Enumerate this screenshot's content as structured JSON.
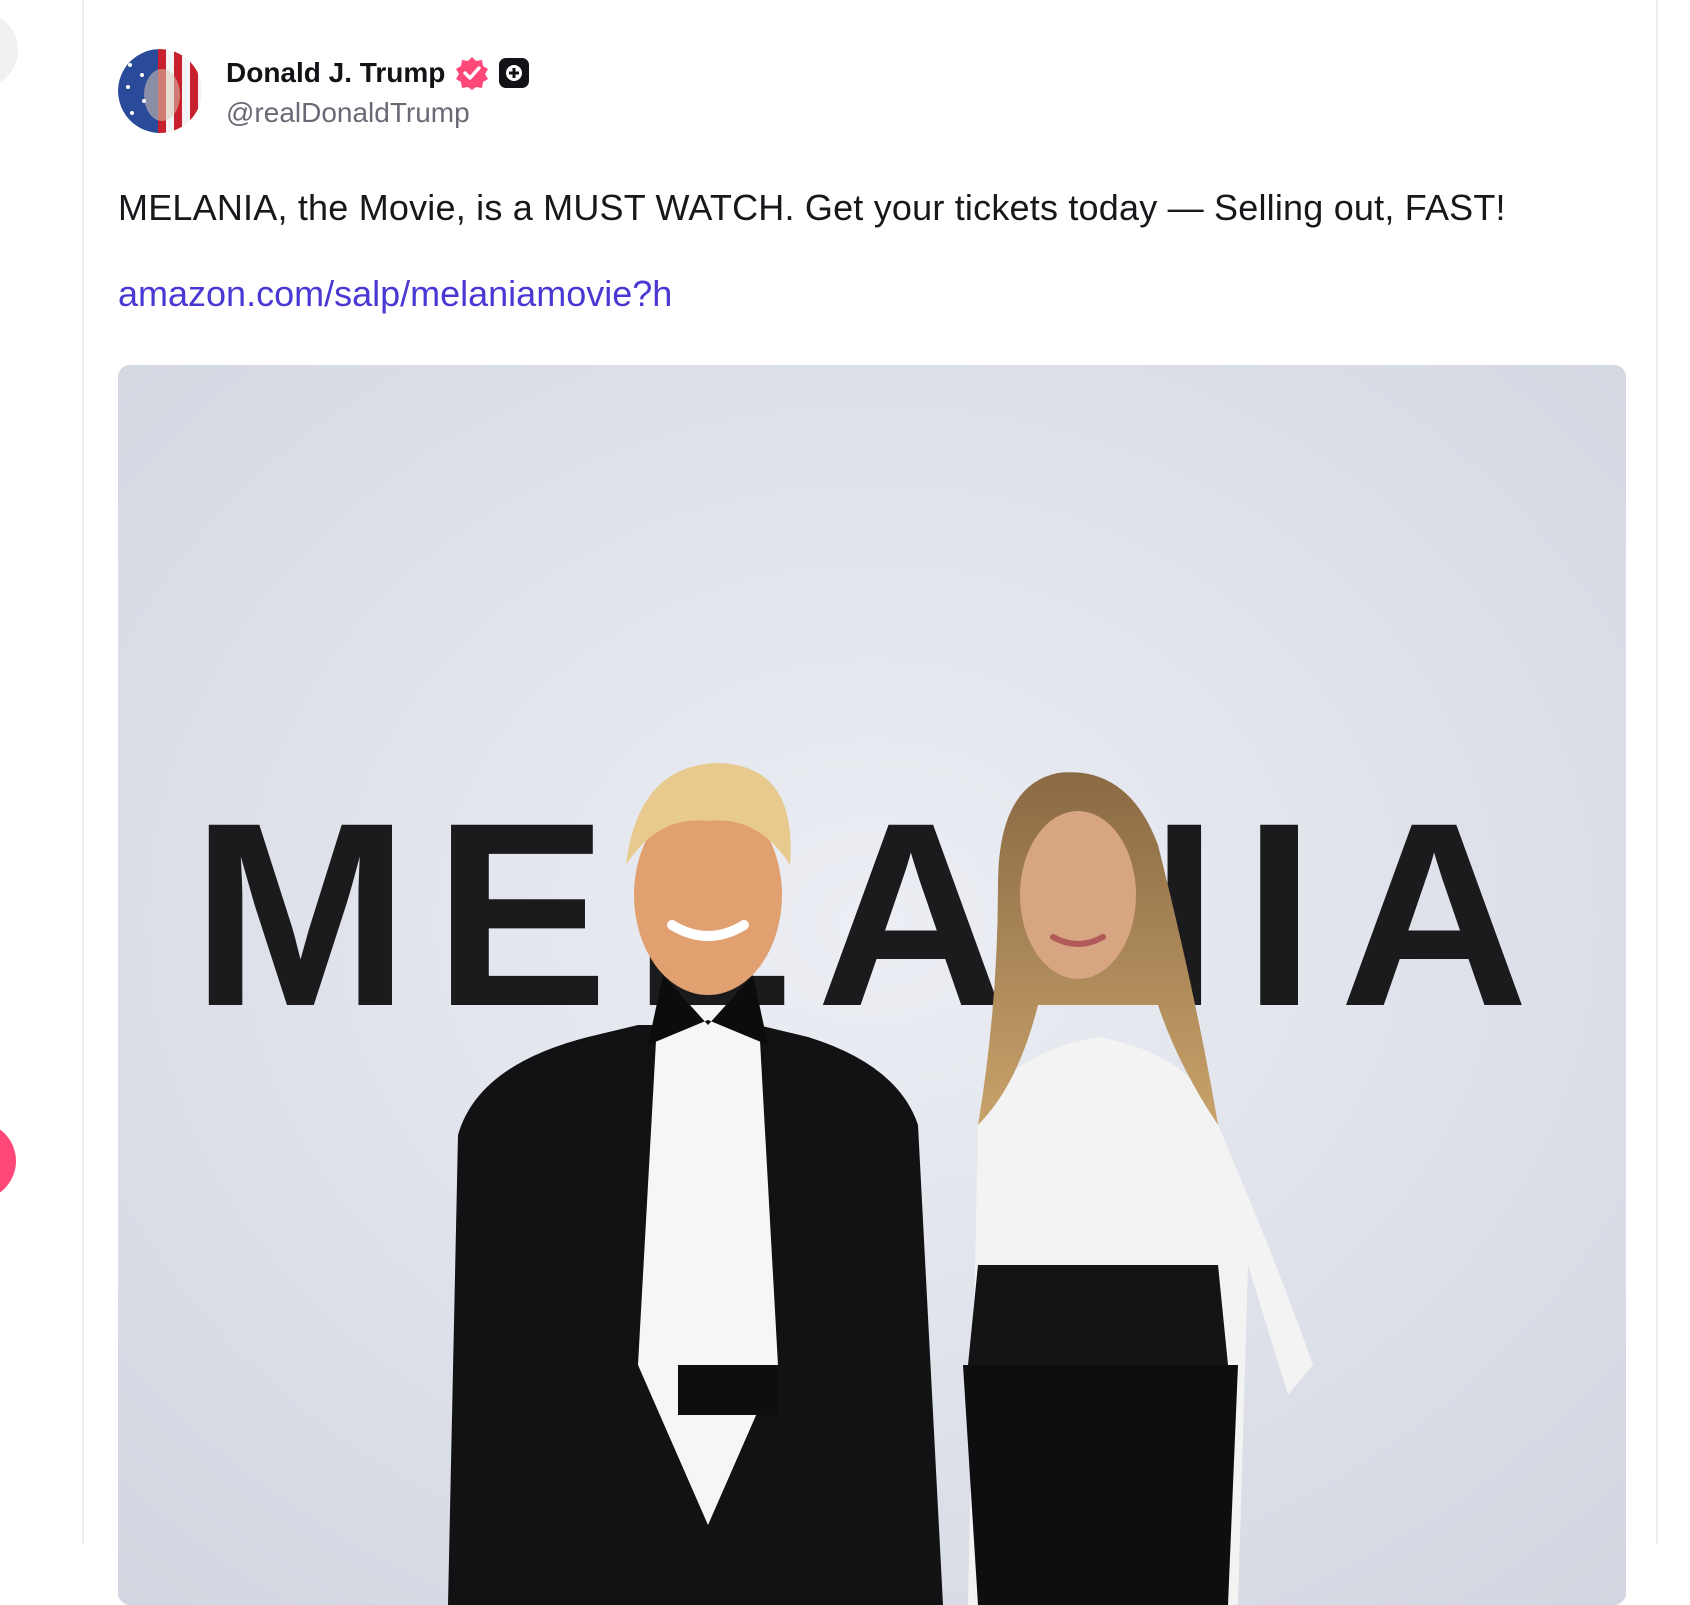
{
  "post": {
    "author": {
      "display_name": "Donald J. Trump",
      "handle": "@realDonaldTrump",
      "verified_icon": "verified-badge-icon",
      "plus_icon": "plus-badge-icon",
      "verified_color": "#ff4778"
    },
    "text": "MELANIA, the Movie, is a MUST WATCH. Get your tickets today — Selling out, FAST!",
    "link": "amazon.com/salp/melaniamovie?h",
    "media": {
      "backdrop_text": "MELANIA"
    }
  },
  "colors": {
    "link": "#4a38d4",
    "accent_pink": "#ff4778",
    "text_primary": "#17171c",
    "text_secondary": "#6a6a76"
  }
}
